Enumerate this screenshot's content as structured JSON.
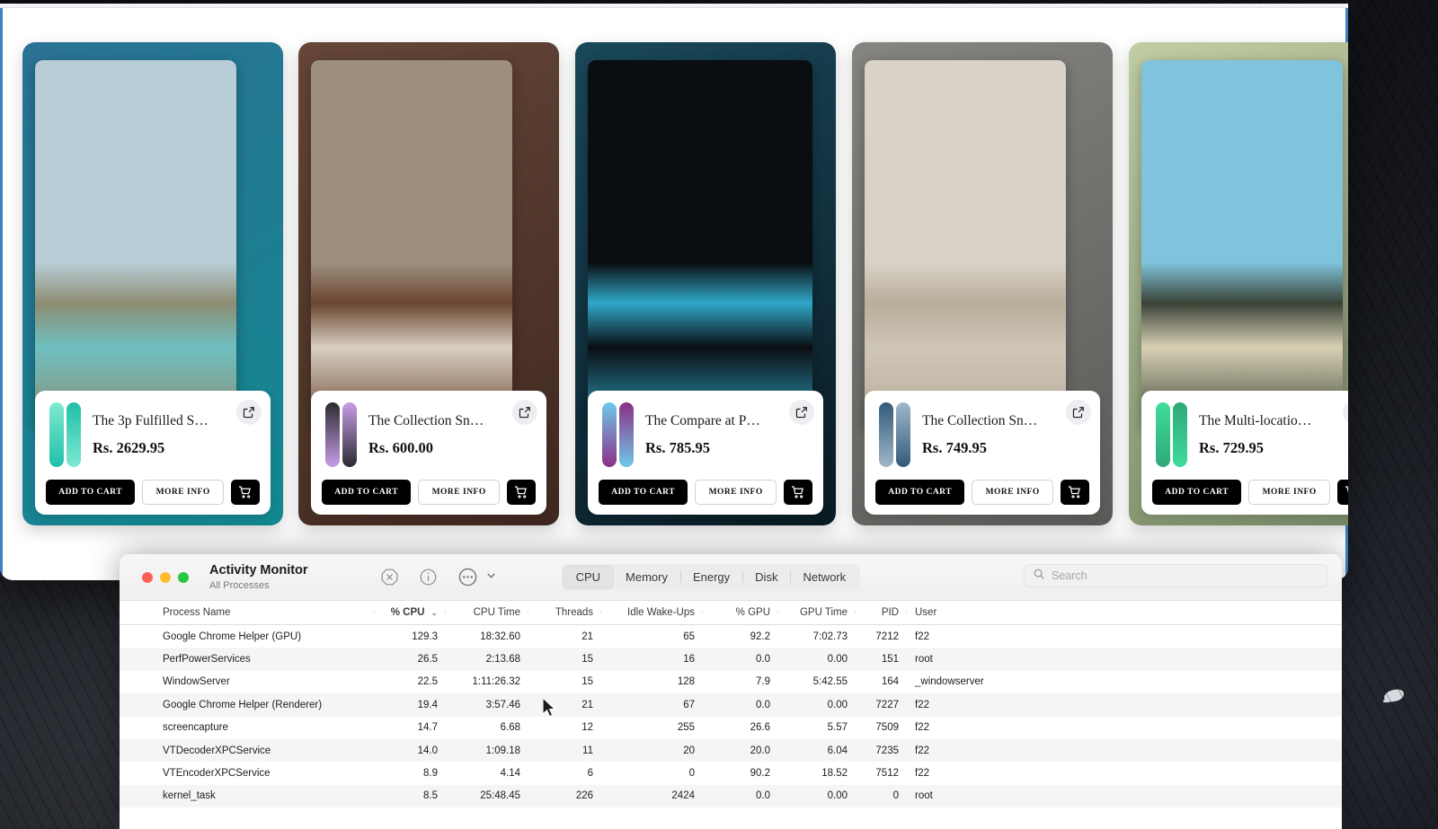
{
  "browser": {
    "products": [
      {
        "title": "The 3p Fulfilled S…",
        "price": "Rs. 2629.95",
        "add_label": "ADD TO CART",
        "info_label": "MORE INFO",
        "board_a": "#7fe9d2",
        "board_b": "#1fbfa8",
        "bg_from": "#2e6f96",
        "bg_to": "#0f8b8f",
        "photo_sky": "#b9cdd6",
        "photo_land": "#8d8d72",
        "photo_water": "#6fbfc0"
      },
      {
        "title": "The Collection Sn…",
        "price": "Rs. 600.00",
        "add_label": "ADD TO CART",
        "info_label": "MORE INFO",
        "board_a": "#2b2b2f",
        "board_b": "#c79ee8",
        "bg_from": "#6b4a3c",
        "bg_to": "#3a241c",
        "photo_sky": "#9d8f7e",
        "photo_land": "#6b4630",
        "photo_water": "#d8cfc2"
      },
      {
        "title": "The Compare at P…",
        "price": "Rs. 785.95",
        "add_label": "ADD TO CART",
        "info_label": "MORE INFO",
        "board_a": "#6fc8ea",
        "board_b": "#8c2f86",
        "bg_from": "#1c4f62",
        "bg_to": "#07141c",
        "photo_sky": "#0a0d12",
        "photo_land": "#2fa8c8",
        "photo_water": "#0a0d12"
      },
      {
        "title": "The Collection Sn…",
        "price": "Rs. 749.95",
        "add_label": "ADD TO CART",
        "info_label": "MORE INFO",
        "board_a": "#335a7a",
        "board_b": "#9fb8c9",
        "bg_from": "#8c8a86",
        "bg_to": "#575553",
        "photo_sky": "#d9d2c6",
        "photo_land": "#b9ad9b",
        "photo_water": "#cfc6b6"
      },
      {
        "title": "The Multi-locatio…",
        "price": "Rs. 729.95",
        "add_label": "ADD TO CART",
        "info_label": "MORE INFO",
        "board_a": "#3fdc9c",
        "board_b": "#2fa878",
        "bg_from": "#cbd6ad",
        "bg_to": "#6b7d5a",
        "photo_sky": "#7fc4dc",
        "photo_land": "#3a4236",
        "photo_water": "#d8d0b4"
      },
      {
        "title": "",
        "price": "",
        "add_label": "",
        "info_label": "",
        "board_a": "#e050a0",
        "board_b": "#d03090",
        "bg_from": "#e84aa8",
        "bg_to": "#9c2f7c",
        "photo_sky": "#f06ab8",
        "photo_land": "#b03a86",
        "photo_water": "#e04fa2"
      }
    ]
  },
  "activity_monitor": {
    "window_title": "Activity Monitor",
    "window_subtitle": "All Processes",
    "toolbar_icons": [
      "quit-process-icon",
      "inspect-process-icon",
      "more-options-icon",
      "chevron-down-icon"
    ],
    "tabs": [
      {
        "label": "CPU",
        "active": true
      },
      {
        "label": "Memory",
        "active": false
      },
      {
        "label": "Energy",
        "active": false
      },
      {
        "label": "Disk",
        "active": false
      },
      {
        "label": "Network",
        "active": false
      }
    ],
    "search": {
      "placeholder": "Search",
      "value": ""
    },
    "columns": [
      {
        "label": "Process Name",
        "align": "left",
        "sorted": false
      },
      {
        "label": "% CPU",
        "align": "right",
        "sorted": true
      },
      {
        "label": "CPU Time",
        "align": "right",
        "sorted": false
      },
      {
        "label": "Threads",
        "align": "right",
        "sorted": false
      },
      {
        "label": "Idle Wake-Ups",
        "align": "right",
        "sorted": false
      },
      {
        "label": "% GPU",
        "align": "right",
        "sorted": false
      },
      {
        "label": "GPU Time",
        "align": "right",
        "sorted": false
      },
      {
        "label": "PID",
        "align": "right",
        "sorted": false
      },
      {
        "label": "User",
        "align": "left",
        "sorted": false
      }
    ],
    "sort_caret": "⌄",
    "rows": [
      {
        "name": "Google Chrome Helper (GPU)",
        "cpu": "129.3",
        "cpu_time": "18:32.60",
        "threads": "21",
        "wakeups": "65",
        "gpu": "92.2",
        "gpu_time": "7:02.73",
        "pid": "7212",
        "user": "f22"
      },
      {
        "name": "PerfPowerServices",
        "cpu": "26.5",
        "cpu_time": "2:13.68",
        "threads": "15",
        "wakeups": "16",
        "gpu": "0.0",
        "gpu_time": "0.00",
        "pid": "151",
        "user": "root"
      },
      {
        "name": "WindowServer",
        "cpu": "22.5",
        "cpu_time": "1:11:26.32",
        "threads": "15",
        "wakeups": "128",
        "gpu": "7.9",
        "gpu_time": "5:42.55",
        "pid": "164",
        "user": "_windowserver"
      },
      {
        "name": "Google Chrome Helper (Renderer)",
        "cpu": "19.4",
        "cpu_time": "3:57.46",
        "threads": "21",
        "wakeups": "67",
        "gpu": "0.0",
        "gpu_time": "0.00",
        "pid": "7227",
        "user": "f22"
      },
      {
        "name": "screencapture",
        "cpu": "14.7",
        "cpu_time": "6.68",
        "threads": "12",
        "wakeups": "255",
        "gpu": "26.6",
        "gpu_time": "5.57",
        "pid": "7509",
        "user": "f22"
      },
      {
        "name": "VTDecoderXPCService",
        "cpu": "14.0",
        "cpu_time": "1:09.18",
        "threads": "11",
        "wakeups": "20",
        "gpu": "20.0",
        "gpu_time": "6.04",
        "pid": "7235",
        "user": "f22"
      },
      {
        "name": "VTEncoderXPCService",
        "cpu": "8.9",
        "cpu_time": "4.14",
        "threads": "6",
        "wakeups": "0",
        "gpu": "90.2",
        "gpu_time": "18.52",
        "pid": "7512",
        "user": "f22"
      },
      {
        "name": "kernel_task",
        "cpu": "8.5",
        "cpu_time": "25:48.45",
        "threads": "226",
        "wakeups": "2424",
        "gpu": "0.0",
        "gpu_time": "0.00",
        "pid": "0",
        "user": "root"
      }
    ]
  }
}
